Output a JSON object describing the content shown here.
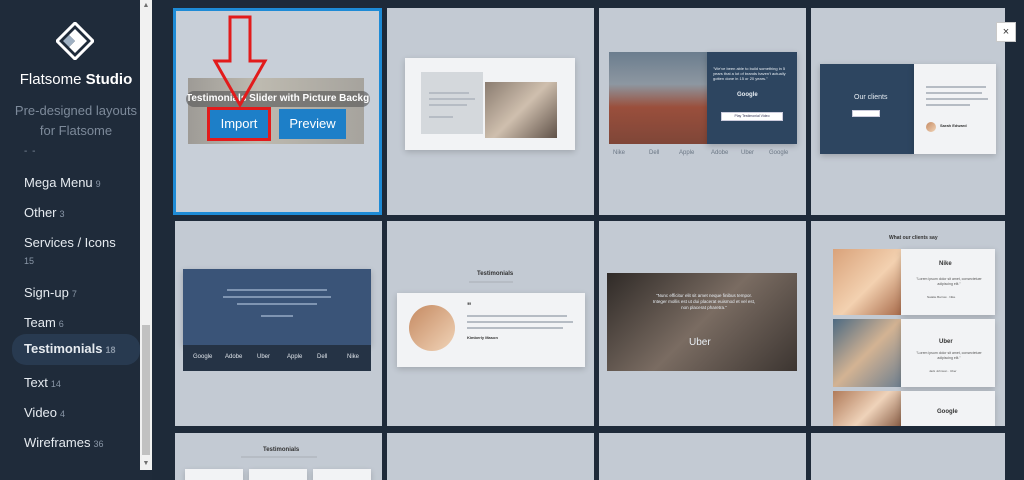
{
  "sidebar": {
    "brand_light": "Flatsome",
    "brand_bold": "Studio",
    "tagline": "Pre-designed layouts for Flatsome",
    "cut_label": "- -",
    "categories": [
      {
        "label": "Mega Menu",
        "count": "9"
      },
      {
        "label": "Other",
        "count": "3"
      },
      {
        "label": "Services / Icons",
        "count": "15"
      },
      {
        "label": "Sign-up",
        "count": "7"
      },
      {
        "label": "Team",
        "count": "6"
      },
      {
        "label": "Testimonials",
        "count": "18",
        "active": true
      },
      {
        "label": "Text",
        "count": "14"
      },
      {
        "label": "Video",
        "count": "4"
      },
      {
        "label": "Wireframes",
        "count": "36"
      }
    ]
  },
  "hover": {
    "title": "Testimonials Slider with Picture Background",
    "import_label": "Import",
    "preview_label": "Preview"
  },
  "close_label": "×",
  "thumbs": {
    "t3_quote": "\"We've been able to build something in 5 years that a lot of brands haven't actually gotten done in 15 or 20 years.\"",
    "t3_brand": "Google",
    "t3_btn": "Play Testimonial Video",
    "t3_logos": [
      "Nike",
      "Dell",
      "Apple",
      "Adobe",
      "Uber",
      "Google"
    ],
    "t4_title": "Our clients",
    "t4_name": "Sarah Edward",
    "t5_logos": [
      "Google",
      "Adobe",
      "Uber",
      "Apple",
      "Dell",
      "Nike"
    ],
    "t6_title": "Testimonials",
    "t6_name": "Kimberly Mason",
    "t7_quote": "\"Nunc efficitur elit sit amet neque finibus tempor. Integer mollis est ut dui placerat euismod et vel est, non placerat pharetra.\"",
    "t7_brand": "Uber",
    "t8_title": "What our clients say",
    "t8_brand1": "Nike",
    "t8_quote": "\"Lorem ipsum dolor sit amet, consectetuer adipiscing elit.\"",
    "t8_name1": "Natalie Barrow · Nike",
    "t8_brand2": "Uber",
    "t8_name2": "Jack Johnson · Uber",
    "t8_brand3": "Google",
    "t9_title": "Testimonials"
  },
  "colors": {
    "sidebar_bg": "#1f2b3a",
    "accent": "#1d7fc8",
    "selected_outline": "#1e8bd6",
    "annotation_red": "#e21b1b"
  }
}
